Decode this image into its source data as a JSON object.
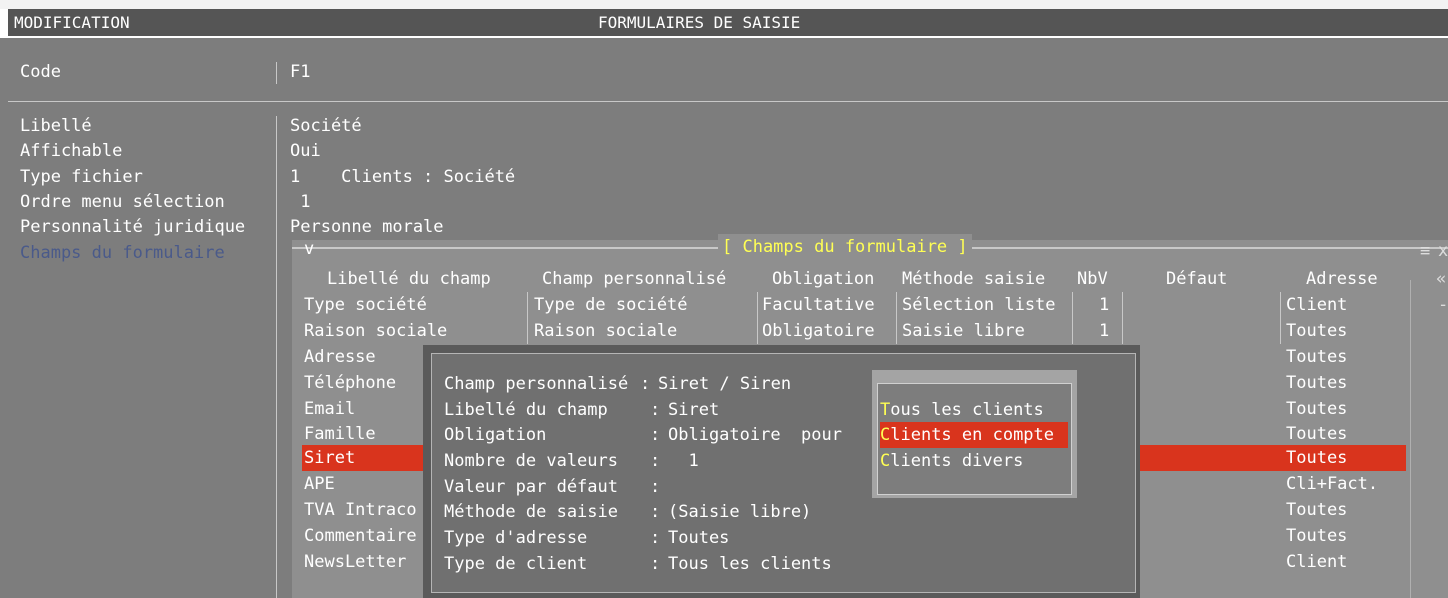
{
  "window": {
    "mode": "MODIFICATION",
    "title": "FORMULAIRES DE SAISIE"
  },
  "code_field": {
    "label": "Code",
    "value": "F1"
  },
  "fields": [
    {
      "label": "Libellé",
      "value": "Société"
    },
    {
      "label": "Affichable",
      "value": "Oui"
    },
    {
      "label": "Type fichier",
      "value": "1    Clients : Société"
    },
    {
      "label": "Ordre menu sélection",
      "value": " 1"
    },
    {
      "label": "Personnalité juridique",
      "value": "Personne morale"
    },
    {
      "label": "Champs du formulaire",
      "value": ""
    }
  ],
  "grid": {
    "title": "[ Champs du formulaire ]",
    "corner_left": "v",
    "menu_glyph": "≡",
    "close_glyph": "x",
    "more_glyph": "«",
    "scroll_glyph": "-",
    "columns": [
      "Libellé du champ",
      "Champ personnalisé",
      "Obligation",
      "Méthode saisie",
      "NbV",
      "Défaut",
      "Adresse"
    ],
    "rows": [
      {
        "libelle": "Type société",
        "champ": "Type de société",
        "obligation": "Facultative",
        "methode": "Sélection liste",
        "nbv": "1",
        "adresse": "Client"
      },
      {
        "libelle": "Raison sociale",
        "champ": "Raison sociale",
        "obligation": "Obligatoire",
        "methode": "Saisie libre",
        "nbv": "1",
        "adresse": "Toutes"
      },
      {
        "libelle": "Adresse",
        "adresse": "Toutes"
      },
      {
        "libelle": "Téléphone",
        "adresse": "Toutes"
      },
      {
        "libelle": "Email",
        "adresse": "Toutes"
      },
      {
        "libelle": "Famille",
        "adresse": "Toutes"
      },
      {
        "libelle": "Siret",
        "adresse": "Toutes"
      },
      {
        "libelle": "APE",
        "adresse": "Cli+Fact."
      },
      {
        "libelle": "TVA Intraco",
        "adresse": "Toutes"
      },
      {
        "libelle": "Commentaire",
        "adresse": "Toutes"
      },
      {
        "libelle": "NewsLetter",
        "adresse": "Client"
      }
    ]
  },
  "popup": {
    "lines": [
      {
        "label": "Champ personnalisé",
        "value": "Siret / Siren"
      },
      {
        "label": "Libellé du champ",
        "value": "Siret"
      },
      {
        "label": "Obligation",
        "value": "Obligatoire  pour"
      },
      {
        "label": "Nombre de valeurs",
        "value": "  1"
      },
      {
        "label": "Valeur par défaut",
        "value": ""
      },
      {
        "label": "Méthode de saisie",
        "value": "(Saisie libre)"
      },
      {
        "label": "Type d'adresse",
        "value": "Toutes"
      },
      {
        "label": "Type de client",
        "value": "Tous les clients"
      }
    ]
  },
  "menu": {
    "items": [
      {
        "hotkey": "T",
        "rest": "ous les clients",
        "selected": false
      },
      {
        "hotkey": "C",
        "rest": "lients en compte",
        "selected": true
      },
      {
        "hotkey": "C",
        "rest": "lients divers",
        "selected": false
      }
    ]
  },
  "colors": {
    "background": "#7d7d7d",
    "title_bar": "#555555",
    "selection": "#d9341d",
    "hotkey": "#ffff54",
    "dim_label": "#4a5a8a"
  }
}
